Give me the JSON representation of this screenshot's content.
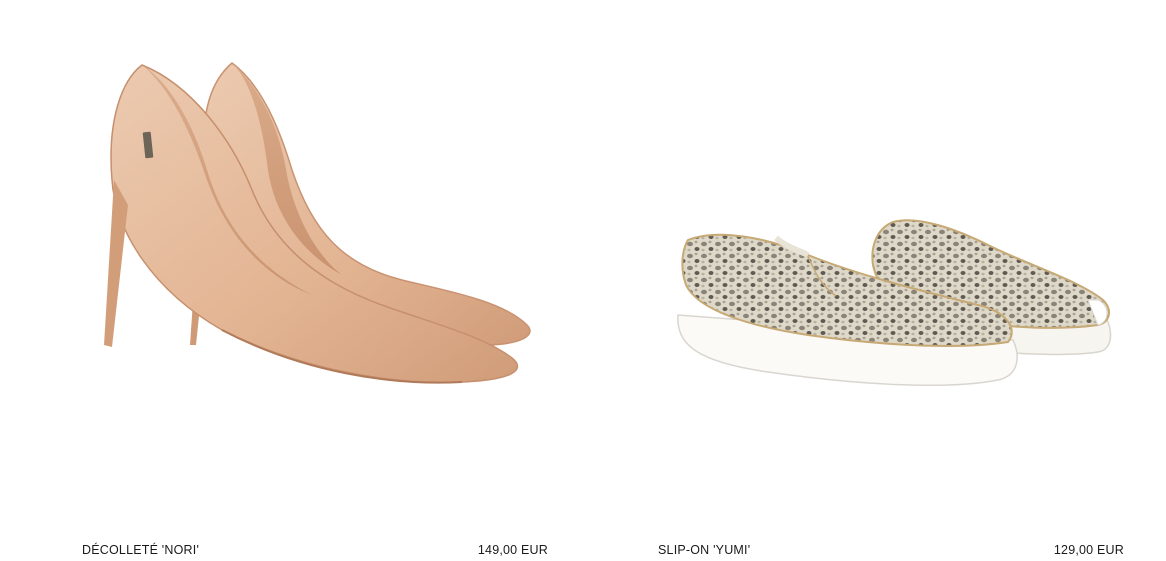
{
  "products": [
    {
      "name": "DÉCOLLETÉ 'NORI'",
      "price": "149,00 EUR",
      "image_icon": "nude-pump-shoe-image",
      "color": "#e7bd9c"
    },
    {
      "name": "SLIP-ON 'YUMI'",
      "price": "129,00 EUR",
      "image_icon": "snake-print-slip-on-image",
      "color": "#cfc8b8"
    }
  ]
}
